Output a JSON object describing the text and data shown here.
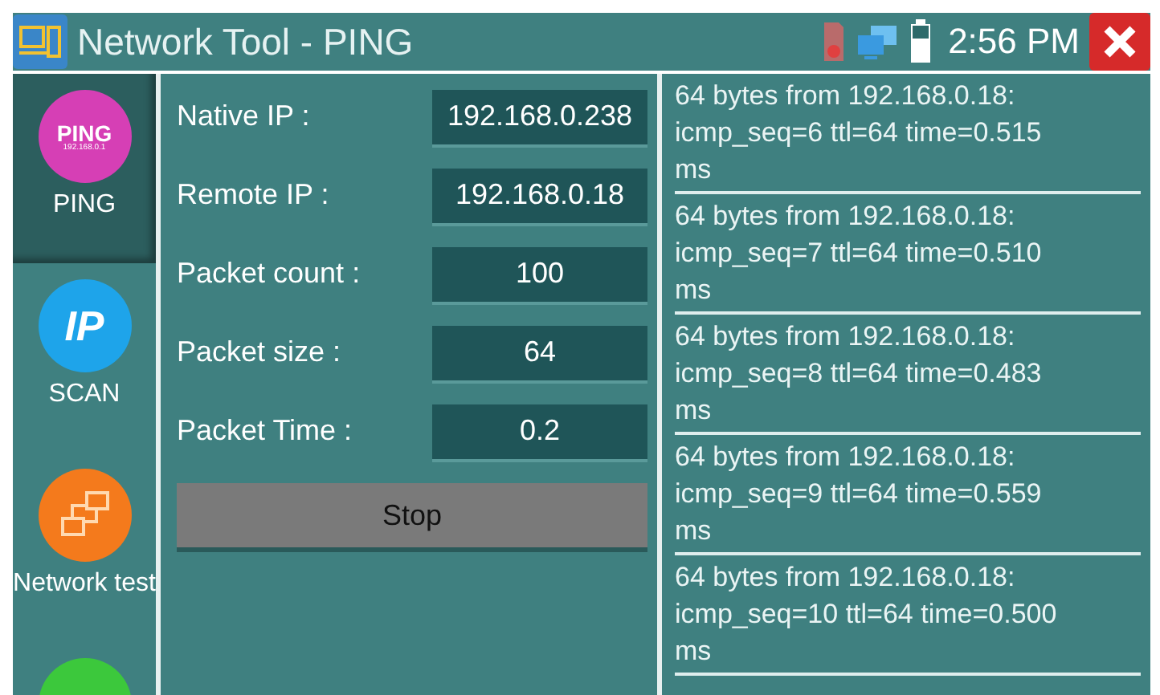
{
  "window": {
    "title": "Network Tool - PING",
    "time": "2:56 PM"
  },
  "sidebar": {
    "items": [
      {
        "kind": "ping",
        "label": "PING",
        "color": "#d63fb5",
        "icon_text": "PING",
        "icon_subtext": "192.168.0.1",
        "selected": true
      },
      {
        "kind": "scan",
        "label": "SCAN",
        "color": "#1ea4ea",
        "icon_text": "IP",
        "selected": false
      },
      {
        "kind": "network",
        "label": "Network test",
        "color": "#f47a1c",
        "selected": false
      },
      {
        "kind": "blank",
        "color": "#3cc83c",
        "selected": false
      }
    ]
  },
  "form": {
    "fields": [
      {
        "label": "Native IP :",
        "value": "192.168.0.238"
      },
      {
        "label": "Remote IP :",
        "value": "192.168.0.18"
      },
      {
        "label": "Packet count :",
        "value": "100"
      },
      {
        "label": "Packet size :",
        "value": "64"
      },
      {
        "label": "Packet Time :",
        "value": "0.2"
      }
    ],
    "button": "Stop"
  },
  "log": [
    "64 bytes from 192.168.0.18:\nicmp_seq=6 ttl=64 time=0.515\nms",
    "64 bytes from 192.168.0.18:\nicmp_seq=7 ttl=64 time=0.510\nms",
    "64 bytes from 192.168.0.18:\nicmp_seq=8 ttl=64 time=0.483\nms",
    "64 bytes from 192.168.0.18:\nicmp_seq=9 ttl=64 time=0.559\nms",
    "64 bytes from 192.168.0.18:\nicmp_seq=10 ttl=64 time=0.500\nms"
  ]
}
